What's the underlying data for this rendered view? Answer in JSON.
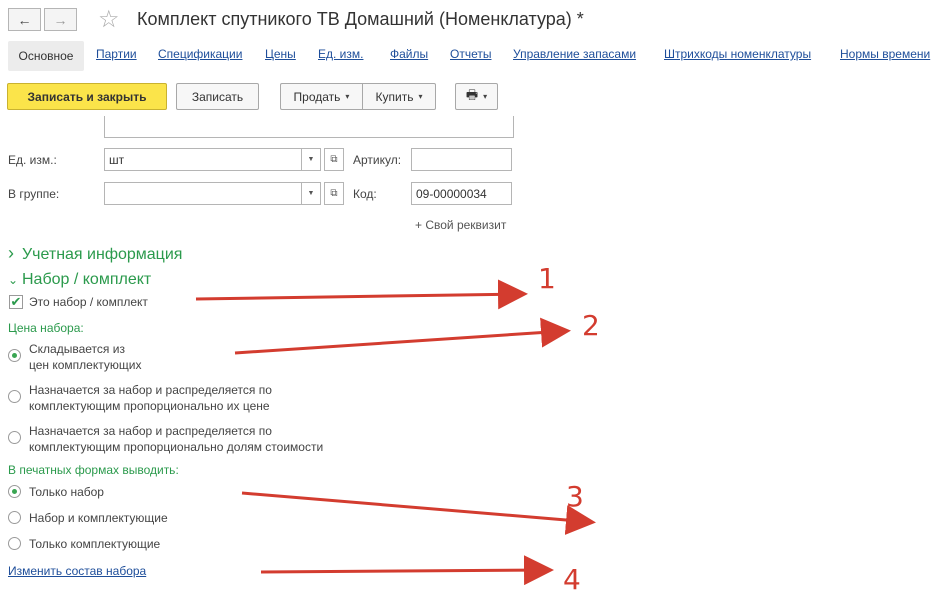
{
  "window": {
    "title": "Комплект спутникого ТВ Домашний (Номенклатура) *"
  },
  "nav": {
    "back_glyph": "←",
    "forward_glyph": "→",
    "star_glyph": "☆"
  },
  "tabs": {
    "active": "Основное",
    "items": [
      "Партии",
      "Спецификации",
      "Цены",
      "Ед. изм.",
      "Файлы",
      "Отчеты",
      "Управление запасами",
      "Штрихкоды номенклатуры",
      "Нормы времени"
    ]
  },
  "toolbar": {
    "save_close": "Записать и закрыть",
    "save": "Записать",
    "sell": "Продать",
    "buy": "Купить",
    "print_glyph": "🖶",
    "caret": "▾"
  },
  "form": {
    "unit_label": "Ед. изм.:",
    "unit_value": "шт",
    "article_label": "Артикул:",
    "article_value": "",
    "group_label": "В группе:",
    "group_value": "",
    "code_label": "Код:",
    "code_value": "09-00000034",
    "own_attr_link": "+ Свой реквизит",
    "dropdown_glyph": "▼",
    "open_glyph": "⧉"
  },
  "sections": {
    "accounting": "Учетная информация",
    "kit": "Набор / комплект",
    "collapsed_glyph": "›",
    "expanded_glyph": "⌄"
  },
  "kit": {
    "is_kit_label": "Это набор / комплект",
    "is_kit_checked": true,
    "check_glyph": "✔",
    "price_heading": "Цена набора:",
    "price_options": [
      {
        "line1": "Складывается из",
        "line2": "цен комплектующих",
        "selected": true
      },
      {
        "line1": "Назначается за набор и распределяется по",
        "line2": "комплектующим пропорционально их цене",
        "selected": false
      },
      {
        "line1": "Назначается за набор и распределяется по",
        "line2": "комплектующим пропорционально долям стоимости",
        "selected": false
      }
    ],
    "print_heading": "В печатных формах выводить:",
    "print_options": [
      {
        "label": "Только набор",
        "selected": true
      },
      {
        "label": "Набор и комплектующие",
        "selected": false
      },
      {
        "label": "Только комплектующие",
        "selected": false
      }
    ],
    "change_link": "Изменить состав набора"
  },
  "annotations": {
    "numbers": [
      "1",
      "2",
      "3",
      "4"
    ],
    "arrow_color": "#d33c2f"
  }
}
